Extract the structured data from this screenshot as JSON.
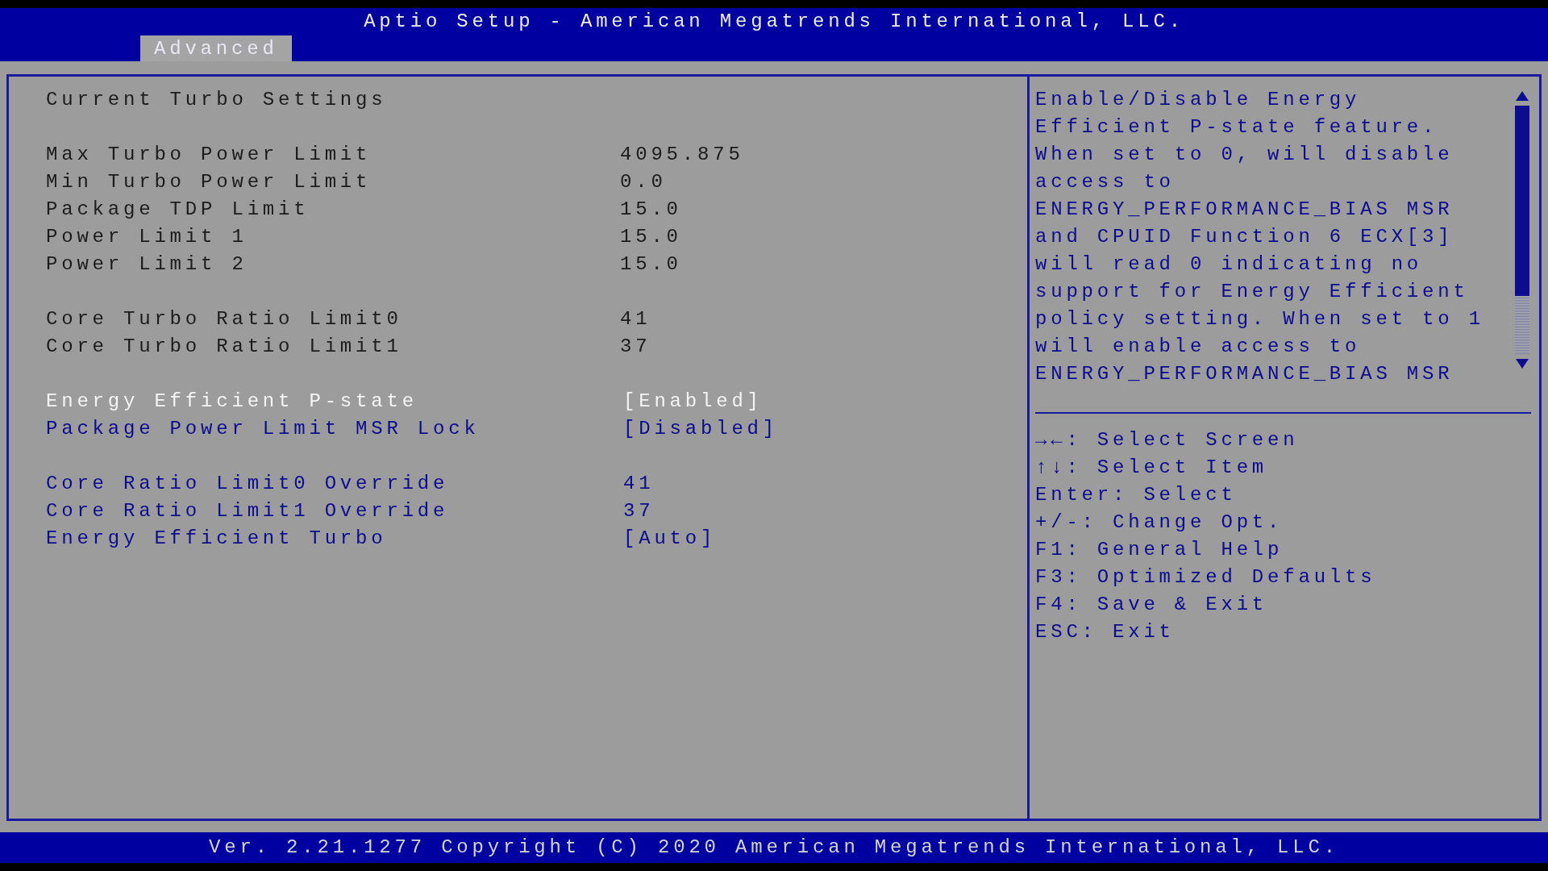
{
  "title": "Aptio Setup - American Megatrends International, LLC.",
  "tabs": [
    {
      "label": "Advanced",
      "selected": true
    }
  ],
  "settings": [
    {
      "items": [
        {
          "kind": "heading",
          "label": "Current Turbo Settings"
        }
      ]
    },
    {
      "items": [
        {
          "kind": "info",
          "label": "Max Turbo Power Limit",
          "value": "4095.875"
        },
        {
          "kind": "info",
          "label": "Min Turbo Power Limit",
          "value": "0.0"
        },
        {
          "kind": "info",
          "label": "Package TDP Limit",
          "value": "15.0"
        },
        {
          "kind": "info",
          "label": "Power Limit 1",
          "value": "15.0"
        },
        {
          "kind": "info",
          "label": "Power Limit 2",
          "value": "15.0"
        }
      ]
    },
    {
      "items": [
        {
          "kind": "info",
          "label": "Core Turbo Ratio Limit0",
          "value": "41"
        },
        {
          "kind": "info",
          "label": "Core Turbo Ratio Limit1",
          "value": "37"
        }
      ]
    },
    {
      "items": [
        {
          "kind": "option",
          "label": "Energy Efficient P-state",
          "value": "[Enabled]",
          "selected": true
        },
        {
          "kind": "option",
          "label": "Package Power Limit MSR Lock",
          "value": "[Disabled]",
          "selected": false
        }
      ]
    },
    {
      "items": [
        {
          "kind": "option",
          "label": "Core Ratio Limit0 Override",
          "value": "41",
          "selected": false
        },
        {
          "kind": "option",
          "label": "Core Ratio Limit1 Override",
          "value": "37",
          "selected": false
        },
        {
          "kind": "option",
          "label": "Energy Efficient Turbo",
          "value": "[Auto]",
          "selected": false
        }
      ]
    }
  ],
  "help_lines": [
    "Enable/Disable Energy",
    "Efficient P-state feature.",
    "When set to 0, will disable",
    "access to",
    "ENERGY_PERFORMANCE_BIAS MSR",
    "and CPUID Function 6 ECX[3]",
    "will read 0 indicating no",
    "support for Energy Efficient",
    "policy setting. When set to 1",
    "will enable access to",
    "ENERGY_PERFORMANCE_BIAS MSR"
  ],
  "key_help": [
    "**→←**: Select Screen",
    "**↑↓**: Select Item",
    "Enter: Select",
    "+/-: Change Opt.",
    "F1: General Help",
    "F3: Optimized Defaults",
    "F4: Save & Exit",
    "ESC: Exit"
  ],
  "footer": "Ver. 2.21.1277 Copyright (C) 2020 American Megatrends International, LLC."
}
